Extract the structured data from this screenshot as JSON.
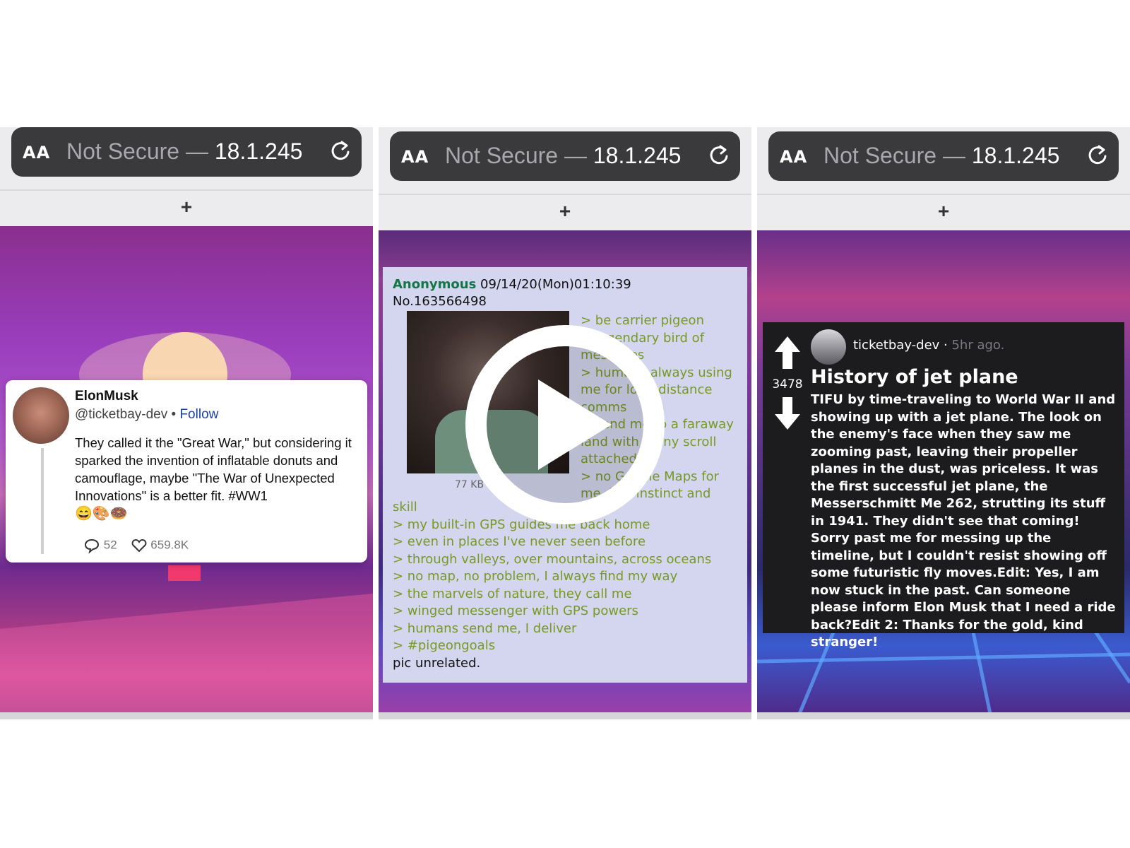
{
  "browser": {
    "aa_label": "AA",
    "url_prefix": "Not Secure — ",
    "url_ip": "18.1.245",
    "new_tab": "+"
  },
  "tweet": {
    "name": "ElonMusk",
    "handle": "@ticketbay-dev",
    "separator": "•",
    "follow": "Follow",
    "text": "They called it the \"Great War,\" but considering it sparked the invention of inflatable donuts and camouflage, maybe \"The War of Unexpected Innovations\" is a better fit. #WW1",
    "emoji": "😄🎨🍩",
    "replies": "52",
    "likes": "659.8K"
  },
  "chan": {
    "name": "Anonymous",
    "datetime": "09/14/20(Mon)01:10:39",
    "post_no": "No.163566498",
    "file_size": "77 KB",
    "greentext_right": "> be carrier pigeon\n> legendary bird of messages\n> humans always using me for long-distance comms\n> send me to a faraway land with a tiny scroll attached\n> no Google Maps for me, just instinct and",
    "greentext_left": [
      "skill",
      "> my built-in GPS guides me back home",
      "> even in places I've never seen before",
      "> through valleys, over mountains, across oceans",
      "> no map, no problem, I always find my way",
      "> the marvels of nature, they call me",
      "> winged messenger with GPS powers",
      "> humans send me, I deliver",
      "> #pigeongoals"
    ],
    "footer": "pic unrelated."
  },
  "reddit": {
    "votes": "3478",
    "user": "ticketbay-dev",
    "dot": " · ",
    "time": "5hr ago.",
    "title": "History of jet plane",
    "body": "TIFU by time-traveling to World War II and showing up with a jet plane. The look on the enemy's face when they saw me zooming past, leaving their propeller planes in the dust, was priceless. It was the first successful jet plane, the Messerschmitt Me 262, strutting its stuff in 1941. They didn't see that coming! Sorry past me for messing up the timeline, but I couldn't resist showing off some futuristic fly moves.Edit: Yes, I am now stuck in the past. Can someone please inform Elon Musk that I need a ride back?Edit 2: Thanks for the gold, kind stranger!"
  },
  "icons": {
    "play": "play-icon",
    "reload": "reload-icon"
  }
}
